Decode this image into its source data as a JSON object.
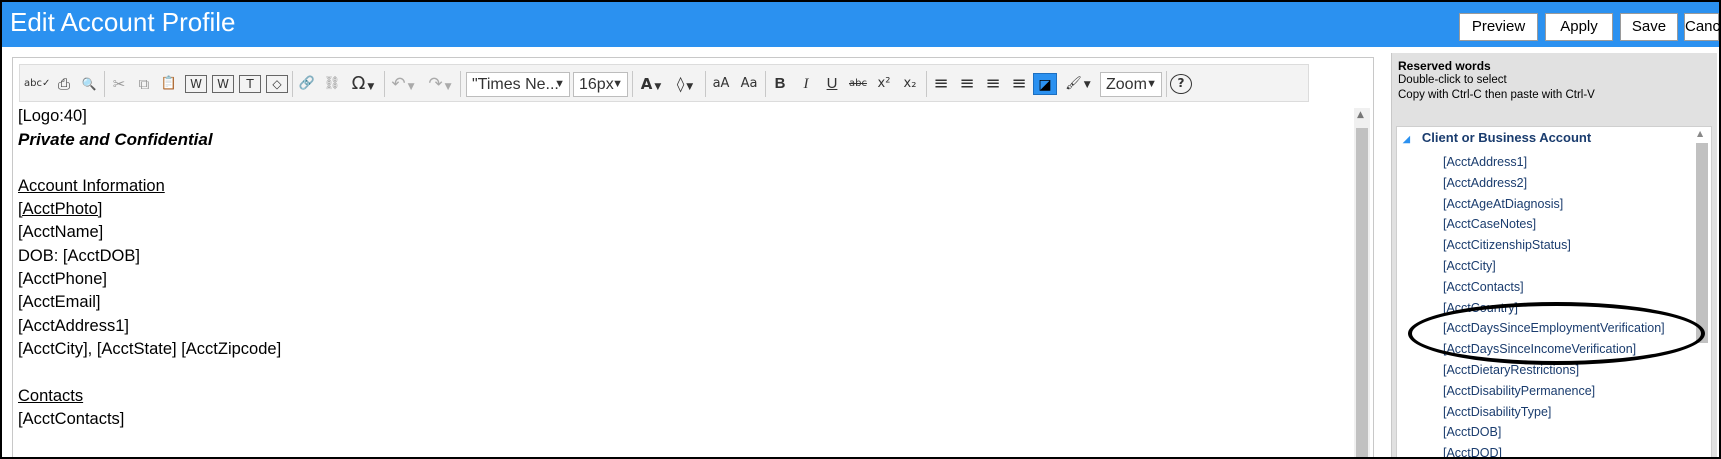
{
  "window": {
    "title": "Edit Account Profile",
    "buttons": {
      "preview": "Preview",
      "apply": "Apply",
      "save": "Save",
      "cancel": "Cancel"
    }
  },
  "toolbar": {
    "font_family": "\"Times Ne...",
    "font_size": "16px",
    "zoom": "Zoom",
    "tools": {
      "spellcheck": "abc✓",
      "print": "⎙",
      "find": "🔍",
      "cut": "✂",
      "copy": "⧉",
      "paste": "📋",
      "paste_word": "W",
      "paste_word2": "W",
      "paste_text": "T",
      "paste_html": "◇",
      "link": "🔗",
      "unlink": "⛓",
      "special_char": "Ω",
      "undo": "↶",
      "redo": "↷",
      "font_color": "A",
      "bg_color": "◊",
      "increase_size": "aA",
      "change_case": "Aa",
      "bold": "B",
      "italic": "I",
      "underline": "U",
      "strike": "abc",
      "superscript": "x²",
      "subscript": "x₂",
      "align_left": "≡",
      "align_center": "≡",
      "align_right": "≡",
      "justify": "≡",
      "clear_format": "◪",
      "format_painter": "🖌",
      "help": "?"
    },
    "icons": [
      "spellcheck-icon",
      "print-icon",
      "find-icon",
      "cut-icon",
      "copy-icon",
      "paste-icon",
      "paste-word-icon",
      "paste-text-icon",
      "link-icon",
      "unlink-icon",
      "special-char-icon",
      "undo-icon",
      "redo-icon",
      "font-color-icon",
      "bg-color-icon",
      "bold-icon",
      "italic-icon",
      "underline-icon",
      "strikethrough-icon",
      "superscript-icon",
      "subscript-icon",
      "align-left-icon",
      "align-center-icon",
      "align-right-icon",
      "justify-icon",
      "clear-format-icon",
      "format-painter-icon",
      "help-icon"
    ]
  },
  "document": {
    "lines": [
      {
        "text": "[Logo:40]",
        "style": ""
      },
      {
        "text": "Private and Confidential",
        "style": "bi"
      },
      {
        "text": "",
        "style": ""
      },
      {
        "text": "Account Information",
        "style": "u"
      },
      {
        "text": "[AcctPhoto]",
        "style": "u"
      },
      {
        "text": "[AcctName]",
        "style": ""
      },
      {
        "text": "DOB: [AcctDOB]",
        "style": ""
      },
      {
        "text": "[AcctPhone]",
        "style": ""
      },
      {
        "text": "[AcctEmail]",
        "style": ""
      },
      {
        "text": "[AcctAddress1]",
        "style": ""
      },
      {
        "text": "[AcctCity], [AcctState] [AcctZipcode]",
        "style": ""
      },
      {
        "text": "",
        "style": ""
      },
      {
        "text": "Contacts",
        "style": "u"
      },
      {
        "text": "[AcctContacts]",
        "style": ""
      }
    ]
  },
  "reserved_words": {
    "title": "Reserved words",
    "hint1": "Double-click to select",
    "hint2": "Copy with Ctrl-C then paste with Ctrl-V",
    "group": "Client or Business Account",
    "items": [
      "[AcctAddress1]",
      "[AcctAddress2]",
      "[AcctAgeAtDiagnosis]",
      "[AcctCaseNotes]",
      "[AcctCitizenshipStatus]",
      "[AcctCity]",
      "[AcctContacts]",
      "[AcctCountry]",
      "[AcctDaysSinceEmploymentVerification]",
      "[AcctDaysSinceIncomeVerification]",
      "[AcctDietaryRestrictions]",
      "[AcctDisabilityPermanence]",
      "[AcctDisabilityType]",
      "[AcctDOB]",
      "[AcctDOD]"
    ]
  },
  "colors": {
    "titlebar": "#2b91f0",
    "accent": "#2b91f0"
  }
}
